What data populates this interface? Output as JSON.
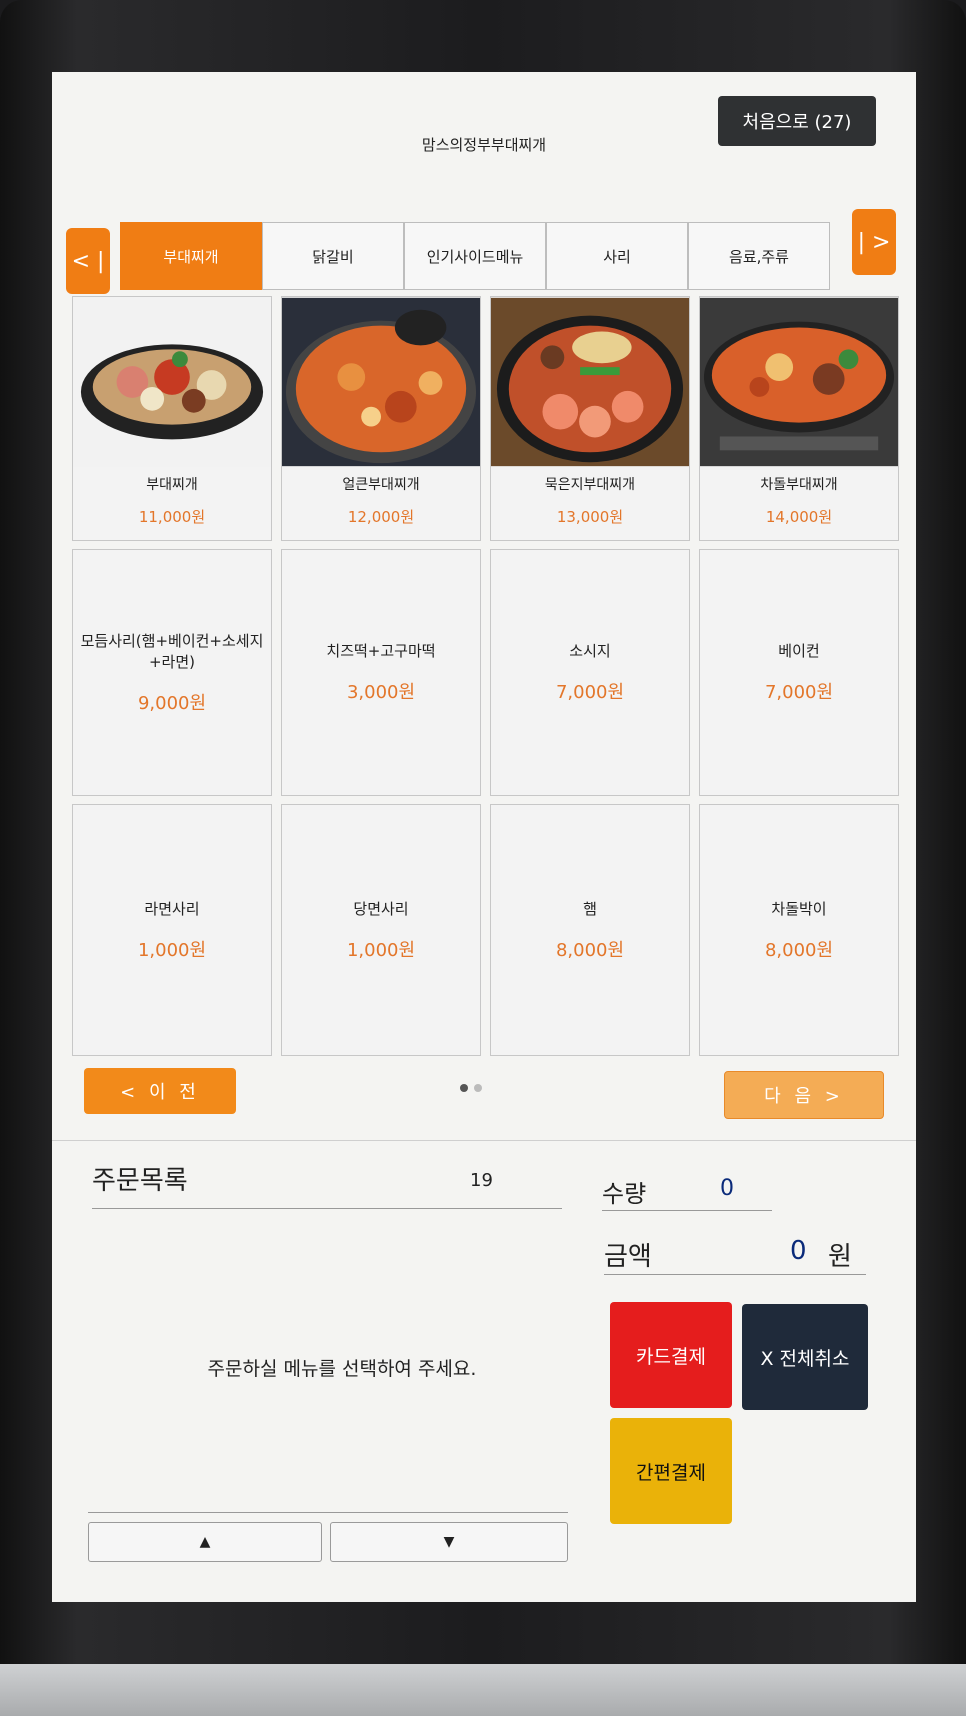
{
  "header": {
    "store_name": "맘스의정부부대찌개",
    "home_button": "처음으로 (27)"
  },
  "tabs": {
    "left_arrow": "< |",
    "right_arrow": "| >",
    "items": [
      {
        "label": "부대찌개",
        "active": true
      },
      {
        "label": "닭갈비",
        "active": false
      },
      {
        "label": "인기사이드메뉴",
        "active": false
      },
      {
        "label": "사리",
        "active": false
      },
      {
        "label": "음료,주류",
        "active": false
      }
    ]
  },
  "menu": [
    {
      "name": "부대찌개",
      "price": "11,000원",
      "image": "bowl-jjigae-icon"
    },
    {
      "name": "얼큰부대찌개",
      "price": "12,000원",
      "image": "spicy-jjigae-icon"
    },
    {
      "name": "묵은지부대찌개",
      "price": "13,000원",
      "image": "kimchi-jjigae-icon"
    },
    {
      "name": "차돌부대찌개",
      "price": "14,000원",
      "image": "brisket-jjigae-icon"
    },
    {
      "name": "모듬사리(햄+베이컨+소세지+라면)",
      "price": "9,000원"
    },
    {
      "name": "치즈떡+고구마떡",
      "price": "3,000원"
    },
    {
      "name": "소시지",
      "price": "7,000원"
    },
    {
      "name": "베이컨",
      "price": "7,000원"
    },
    {
      "name": "라면사리",
      "price": "1,000원"
    },
    {
      "name": "당면사리",
      "price": "1,000원"
    },
    {
      "name": "햄",
      "price": "8,000원"
    },
    {
      "name": "차돌박이",
      "price": "8,000원"
    }
  ],
  "pager": {
    "prev": "< 이 전",
    "next": "다 음 >"
  },
  "order": {
    "title": "주문목록",
    "count": "19",
    "empty_message": "주문하실 메뉴를 선택하여 주세요.",
    "scroll_up": "▲",
    "scroll_down": "▼"
  },
  "summary": {
    "qty_label": "수량",
    "qty_value": "0",
    "amount_label": "금액",
    "amount_value": "0",
    "amount_unit": "원"
  },
  "actions": {
    "card_pay": "카드결제",
    "cancel_all": "X 전체취소",
    "easy_pay": "간편결제"
  },
  "colors": {
    "accent": "#f07d14",
    "price": "#e3762a",
    "card_pay": "#e51d1d",
    "cancel": "#1f2a3a",
    "easy_pay": "#eab209"
  }
}
